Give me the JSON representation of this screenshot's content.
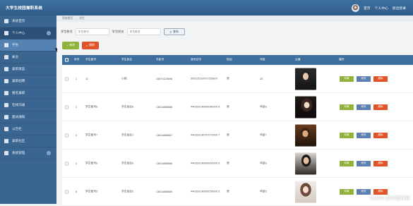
{
  "app": {
    "title": "大学生校园兼职系统"
  },
  "topbar": {
    "link_home": "首页",
    "link_profile": "个人中心",
    "link_logout": "退出登录"
  },
  "sidebar": {
    "items": [
      {
        "label": "系统首页"
      },
      {
        "label": "个人中心"
      },
      {
        "label": "学生"
      },
      {
        "label": "雇主"
      },
      {
        "label": "兼职类型"
      },
      {
        "label": "兼职招聘"
      },
      {
        "label": "报名兼职"
      },
      {
        "label": "在线沟通"
      },
      {
        "label": "面试通知"
      },
      {
        "label": "公告栏"
      },
      {
        "label": "兼职社区"
      },
      {
        "label": "系统管理"
      }
    ]
  },
  "breadcrumb": {
    "home": "系统首页",
    "current": "学生"
  },
  "search": {
    "label_no": "学生账号",
    "placeholder_no": "学生账号",
    "label_name": "学生姓名",
    "placeholder_name": "学生姓名",
    "button": "查询"
  },
  "toolbar": {
    "add_label": "新增",
    "delete_label": "删除"
  },
  "table": {
    "columns": [
      "序号",
      "学生账号",
      "学生姓名",
      "手机号",
      "身份证号",
      "性别",
      "年龄",
      "头像",
      "操作"
    ],
    "rows": [
      {
        "index": "1",
        "account": "11",
        "name": "小莉",
        "phone": "15874123698",
        "idcard": "500225199707256876",
        "gender": "男",
        "age": "25",
        "photo": "photo-1"
      },
      {
        "index": "2",
        "account": "学生账号8",
        "name": "学生姓名8",
        "phone": "13823888888",
        "idcard": "440300199908080000 8",
        "gender": "男",
        "age": "年龄8",
        "photo": "photo-2"
      },
      {
        "index": "3",
        "account": "学生账号7",
        "name": "学生姓名7",
        "phone": "13823888887",
        "idcard": "440300199707070000 7",
        "gender": "男",
        "age": "年龄7",
        "photo": "photo-3"
      },
      {
        "index": "4",
        "account": "学生账号6",
        "name": "学生姓名6",
        "phone": "13823888886",
        "idcard": "440300199606060000 6",
        "gender": "男",
        "age": "年龄6",
        "photo": "photo-4"
      },
      {
        "index": "5",
        "account": "学生账号5",
        "name": "学生姓名5",
        "phone": "13823888885",
        "idcard": "440300199505050000 5",
        "gender": "男",
        "age": "年龄5",
        "photo": "photo-5"
      }
    ],
    "op_detail": "详情",
    "op_edit": "修改",
    "op_delete": "删除"
  },
  "watermark": "CSDN @叶宝科技",
  "colors": {
    "header": "#3e6f9e",
    "sidebar": "#3b6591",
    "green": "#8fb23a",
    "red": "#e1542b",
    "blue": "#5b7fb0"
  }
}
